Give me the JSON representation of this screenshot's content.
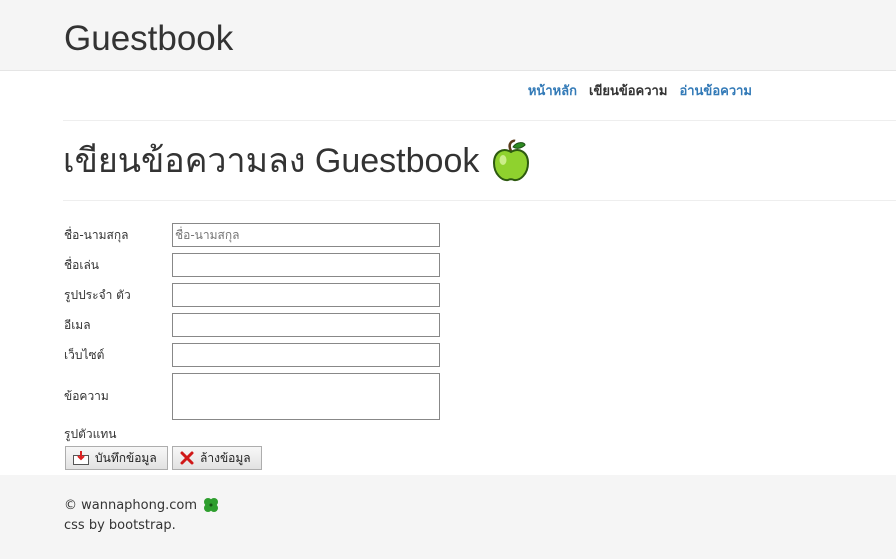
{
  "header": {
    "site_title": "Guestbook"
  },
  "nav": {
    "home": "หน้าหลัก",
    "write": "เขียนข้อความ",
    "read": "อ่านข้อความ"
  },
  "page": {
    "title": "เขียนข้อความลง Guestbook"
  },
  "form": {
    "name_label": "ชื่อ-นามสกุล",
    "name_placeholder": "ชื่อ-นามสกุล",
    "nickname_label": "ชื่อเล่น",
    "photo_label": "รูปประจำ ตัว",
    "email_label": "อีเมล",
    "website_label": "เว็บไซต์",
    "message_label": "ข้อความ",
    "avatar_label": "รูปตัวแทน",
    "save_label": "บันทึกข้อมูล",
    "clear_label": "ล้างข้อมูล"
  },
  "footer": {
    "copyright": "© wannaphong.com",
    "credit": "css by bootstrap."
  },
  "colors": {
    "link": "#337ab7",
    "header_bg": "#f5f5f5"
  }
}
